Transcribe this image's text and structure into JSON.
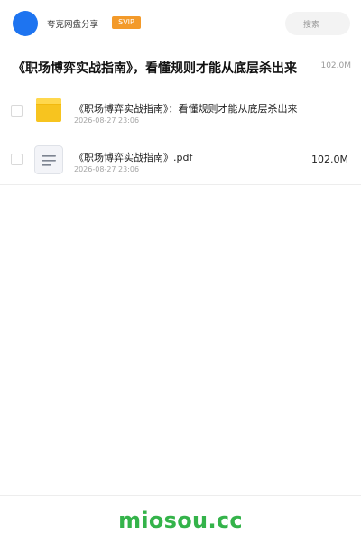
{
  "header": {
    "brand": "夸克网盘分享",
    "badge": "SVIP",
    "search_label": "搜索"
  },
  "share": {
    "title": "《职场博弈实战指南》，看懂规则才能从底层杀出来",
    "total_size": "102.0M"
  },
  "files": [
    {
      "name": "《职场博弈实战指南》：看懂规则才能从底层杀出来",
      "date": "2026-08-27 23:06",
      "size": "",
      "icon": "folder-icon"
    },
    {
      "name": "《职场博弈实战指南》.pdf",
      "date": "2026-08-27 23:06",
      "size": "102.0M",
      "icon": "document-icon"
    }
  ],
  "footer": {
    "text": "miosou.cc"
  },
  "colors": {
    "accent": "#1e74f0",
    "badge": "#f39a2a",
    "folder": "#f7c41f",
    "footer_text": "#34b34a"
  }
}
